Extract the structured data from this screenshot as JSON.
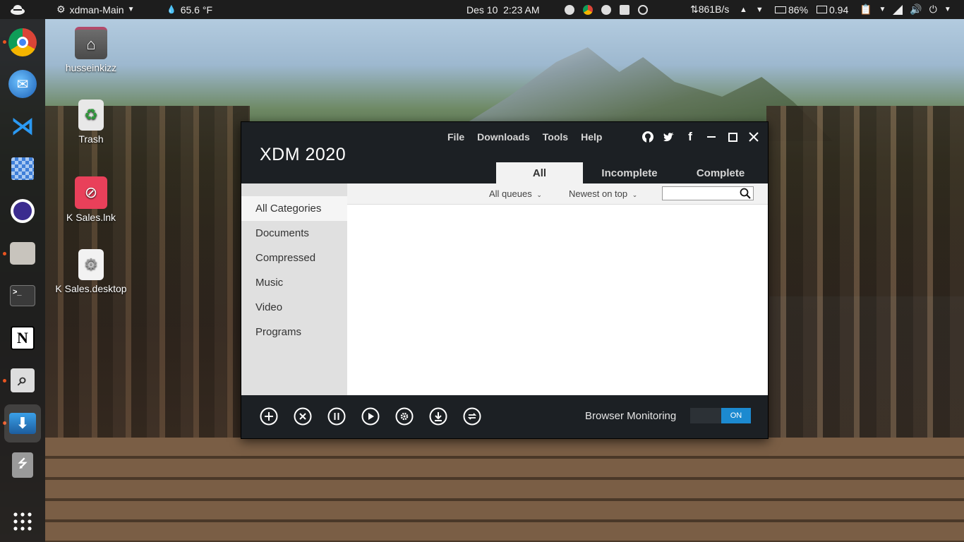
{
  "topbar": {
    "app_menu": "xdman-Main",
    "weather": "65.6 °F",
    "datetime": "Des 10  2:23 AM",
    "net_speed": "⇅861B/s",
    "battery": "86%",
    "load": "0.94"
  },
  "desktop": {
    "icons": [
      {
        "label": "husseinkizz"
      },
      {
        "label": "Trash"
      },
      {
        "label": "K Sales.lnk"
      },
      {
        "label": "K Sales.desktop"
      }
    ]
  },
  "xdm": {
    "title": "XDM 2020",
    "menu": [
      "File",
      "Downloads",
      "Tools",
      "Help"
    ],
    "tabs": [
      "All",
      "Incomplete",
      "Complete"
    ],
    "categories": [
      "All Categories",
      "Documents",
      "Compressed",
      "Music",
      "Video",
      "Programs"
    ],
    "filter": {
      "queues": "All queues",
      "sort": "Newest on top",
      "search_value": ""
    },
    "browser_monitoring_label": "Browser Monitoring",
    "toggle_state": "ON"
  },
  "colors": {
    "accent": "#1c8ad0",
    "window_bg": "#1c2024",
    "ubuntu_orange": "#e95420"
  }
}
